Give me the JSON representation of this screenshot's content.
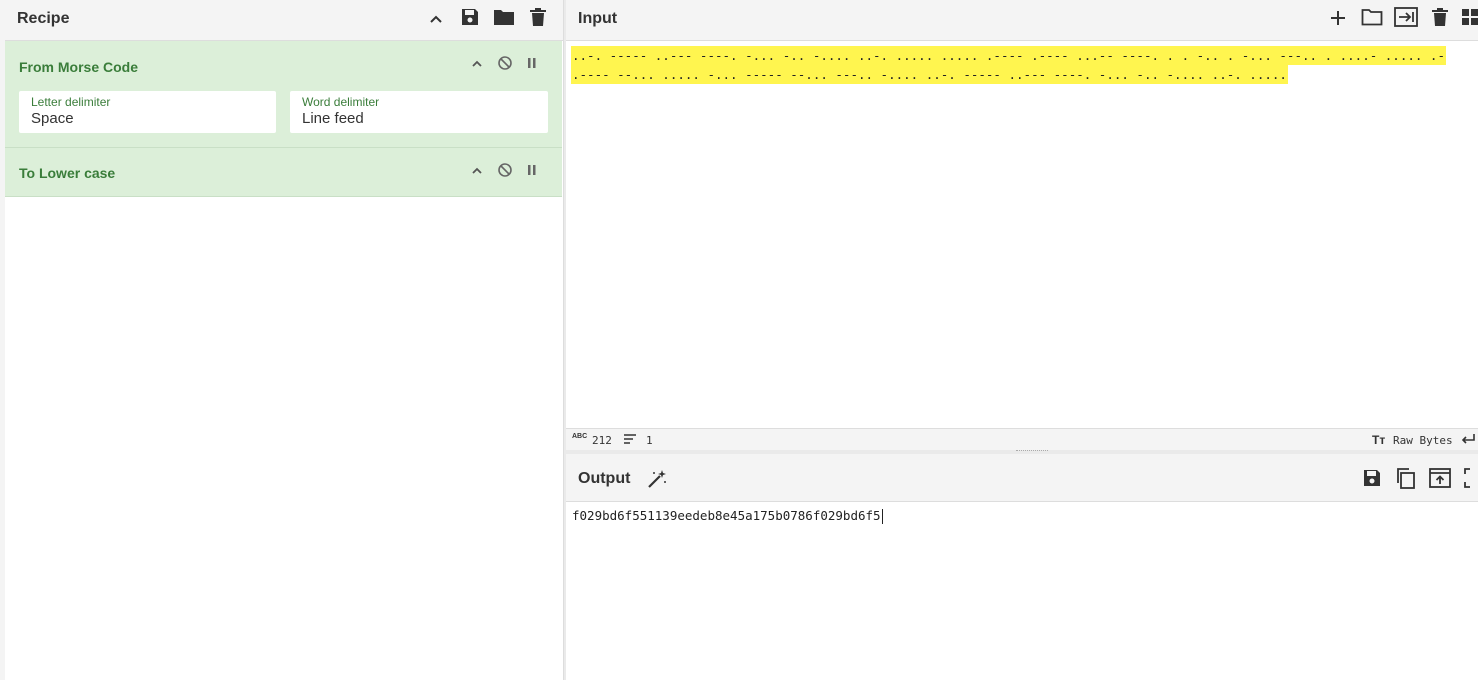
{
  "recipe": {
    "title": "Recipe",
    "operations": [
      {
        "name": "From Morse Code",
        "fields": [
          {
            "label": "Letter delimiter",
            "value": "Space"
          },
          {
            "label": "Word delimiter",
            "value": "Line feed"
          }
        ]
      },
      {
        "name": "To Lower case"
      }
    ],
    "icons": [
      "chevron-up-icon",
      "save-icon",
      "folder-icon",
      "trash-icon"
    ]
  },
  "input": {
    "title": "Input",
    "lines": [
      "..-. ----- ..--- ----. -... -.. -.... ..-. ..... ..... .---- .---- ...-- ----. . . -.. . -... ---.. . ....- ..... .-",
      ".---- --... ..... -... ----- --... ---.. -.... ..-. ----- ..--- ----. -... -.. -.... ..-. ....."
    ],
    "highlight_color": "#fff54f",
    "icons": [
      "plus-icon",
      "folder-icon",
      "import-icon",
      "trash-icon",
      "layout-icon"
    ]
  },
  "status": {
    "length_label": "212",
    "lines_label": "1",
    "encoding_label": "Raw Bytes"
  },
  "output": {
    "title": "Output",
    "text": "f029bd6f551139eedeb8e45a175b0786f029bd6f5",
    "icons": [
      "magic-wand-icon",
      "save-icon",
      "copy-icon",
      "replace-input-icon",
      "maximize-icon"
    ]
  },
  "colors": {
    "operation_bg": "#dcefd9",
    "operation_text": "#3a7d3a",
    "panel_header_bg": "#f4f4f4"
  }
}
